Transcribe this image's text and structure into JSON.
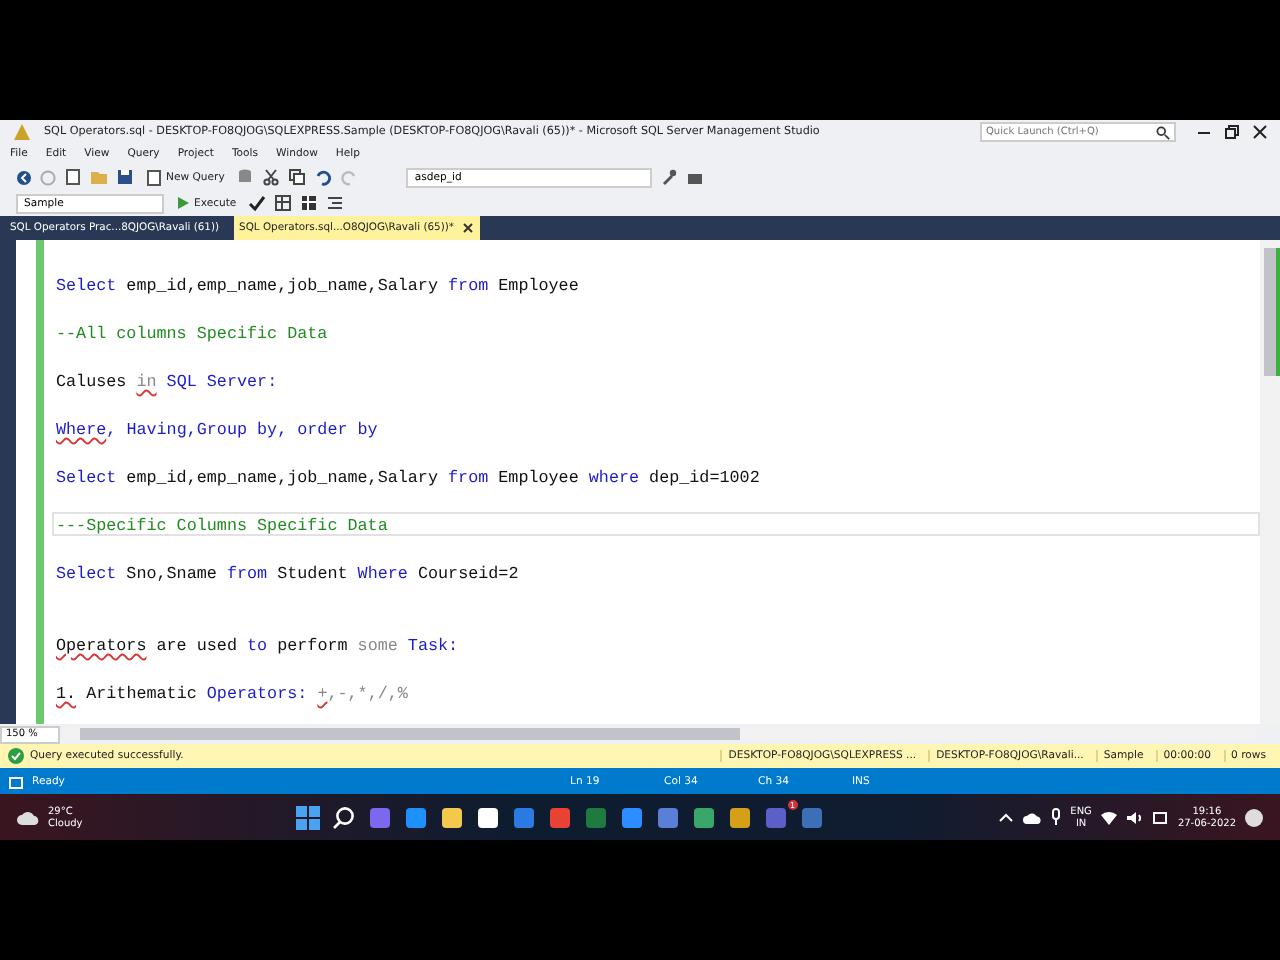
{
  "window": {
    "title": "SQL Operators.sql - DESKTOP-FO8QJOG\\SQLEXPRESS.Sample (DESKTOP-FO8QJOG\\Ravali (65))* - Microsoft SQL Server Management Studio",
    "quick_launch": {
      "placeholder": "Quick Launch (Ctrl+Q)"
    }
  },
  "menu": [
    "File",
    "Edit",
    "View",
    "Query",
    "Project",
    "Tools",
    "Window",
    "Help"
  ],
  "toolbar": {
    "new_query": "New Query",
    "database": "Sample",
    "execute": "Execute",
    "search_combo": "asdep_id"
  },
  "tabs": [
    {
      "label": "SQL Operators Prac...8QJOG\\Ravali (61))",
      "selected": false
    },
    {
      "label": "SQL Operators.sql...O8QJOG\\Ravali (65))*",
      "selected": true
    }
  ],
  "editor": {
    "lines": [
      {
        "current": false,
        "tokens": [
          {
            "text": "Select",
            "kind": "keyword",
            "squiggle": false
          },
          {
            "text": " emp_id,emp_name,job_name,Salary ",
            "kind": "text",
            "squiggle": false
          },
          {
            "text": "from",
            "kind": "keyword",
            "squiggle": false
          },
          {
            "text": " Employee",
            "kind": "text",
            "squiggle": false
          }
        ]
      },
      {
        "current": false
      },
      {
        "current": false,
        "tokens": [
          {
            "text": "--All columns Specific Data",
            "kind": "comment",
            "squiggle": false
          }
        ]
      },
      {
        "current": false
      },
      {
        "current": false,
        "tokens": [
          {
            "text": "Caluses ",
            "kind": "text",
            "squiggle": false
          },
          {
            "text": "in",
            "kind": "faint",
            "squiggle": true
          },
          {
            "text": " SQL Server:",
            "kind": "keyword",
            "squiggle": false
          }
        ]
      },
      {
        "current": false
      },
      {
        "current": false,
        "tokens": [
          {
            "text": "Where",
            "kind": "keyword",
            "squiggle": true
          },
          {
            "text": ", Having,Group by, order by",
            "kind": "keyword",
            "squiggle": false
          }
        ]
      },
      {
        "current": false
      },
      {
        "current": false,
        "tokens": [
          {
            "text": "Select",
            "kind": "keyword",
            "squiggle": false
          },
          {
            "text": " emp_id,emp_name,job_name,Salary ",
            "kind": "text",
            "squiggle": false
          },
          {
            "text": "from",
            "kind": "keyword",
            "squiggle": false
          },
          {
            "text": " Employee ",
            "kind": "text",
            "squiggle": false
          },
          {
            "text": "where",
            "kind": "keyword",
            "squiggle": false
          },
          {
            "text": " dep_id=1002",
            "kind": "text",
            "squiggle": false
          }
        ]
      },
      {
        "current": false
      },
      {
        "current": true,
        "tokens": [
          {
            "text": "---Specific Columns Specific Data",
            "kind": "comment",
            "squiggle": false
          }
        ]
      },
      {
        "current": false
      },
      {
        "current": false,
        "tokens": [
          {
            "text": "Select",
            "kind": "keyword",
            "squiggle": false
          },
          {
            "text": " Sno,Sname ",
            "kind": "text",
            "squiggle": false
          },
          {
            "text": "from",
            "kind": "keyword",
            "squiggle": false
          },
          {
            "text": " Student ",
            "kind": "text",
            "squiggle": false
          },
          {
            "text": "Where",
            "kind": "keyword",
            "squiggle": false
          },
          {
            "text": " Courseid=2",
            "kind": "text",
            "squiggle": false
          }
        ]
      },
      {
        "current": false
      },
      {
        "current": false
      },
      {
        "current": false,
        "tokens": [
          {
            "text": "Operators",
            "kind": "text",
            "squiggle": true
          },
          {
            "text": " are used ",
            "kind": "text",
            "squiggle": false
          },
          {
            "text": "to",
            "kind": "keyword",
            "squiggle": false
          },
          {
            "text": " perform ",
            "kind": "text",
            "squiggle": false
          },
          {
            "text": "some",
            "kind": "faint",
            "squiggle": false
          },
          {
            "text": " Task:",
            "kind": "keyword",
            "squiggle": false
          }
        ]
      },
      {
        "current": false
      },
      {
        "current": false,
        "tokens": [
          {
            "text": "1.",
            "kind": "text",
            "squiggle": true
          },
          {
            "text": " Arithematic ",
            "kind": "text",
            "squiggle": false
          },
          {
            "text": "Operators: ",
            "kind": "keyword",
            "squiggle": false
          },
          {
            "text": "+",
            "kind": "faint",
            "squiggle": true
          },
          {
            "text": ",-,*,/,%",
            "kind": "faint",
            "squiggle": false
          }
        ]
      }
    ],
    "zoom": "150 %"
  },
  "query_status": {
    "message": "Query executed successfully.",
    "segments": [
      "DESKTOP-FO8QJOG\\SQLEXPRESS ...",
      "DESKTOP-FO8QJOG\\Ravali...",
      "Sample",
      "00:00:00",
      "0 rows"
    ]
  },
  "status_bar": {
    "state": "Ready",
    "fields": [
      "Ln 19",
      "Col 34",
      "Ch 34",
      "INS"
    ]
  },
  "taskbar": {
    "temperature": "29°C",
    "weather": "Cloudy",
    "language": "ENG",
    "region": "IN",
    "time": "19:16",
    "date": "27-06-2022",
    "teams_badge": "1"
  }
}
